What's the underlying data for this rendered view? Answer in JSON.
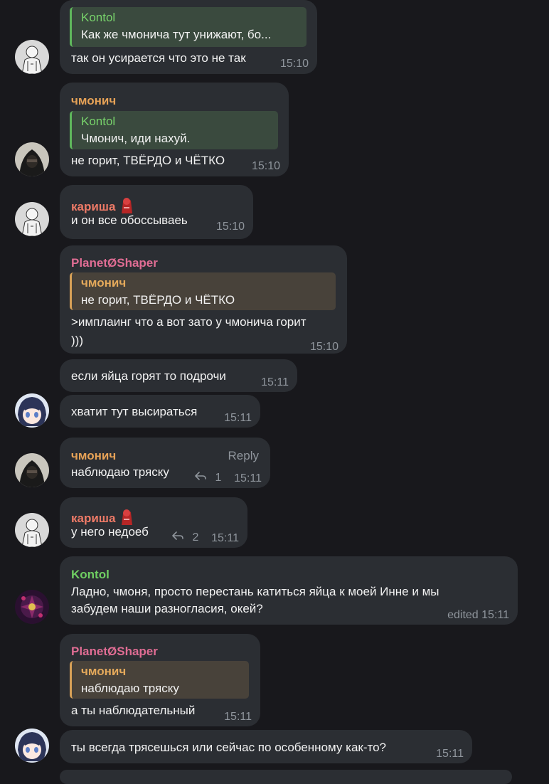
{
  "colors": {
    "background": "#18181c",
    "bubble": "#2b2e33",
    "name_chmonich": "#e6a257",
    "name_karisha": "#ee7a67",
    "name_planet": "#e06d94",
    "name_kontol": "#6fcf62",
    "time": "#8f959c"
  },
  "messages": [
    {
      "quote": {
        "name": "Kontol",
        "text": "Как же чмонича тут унижают, бо..."
      },
      "text": "так он усирается что это не так",
      "time": "15:10"
    },
    {
      "sender": "чмонич",
      "quote": {
        "name": "Kontol",
        "text": "Чмонич, иди нахуй."
      },
      "text": "не горит, ТВЁРДО и ЧЁТКО",
      "time": "15:10"
    },
    {
      "sender": "кариша",
      "text": "и он все обоссываеь",
      "time": "15:10"
    },
    {
      "sender": "PlanetØShaper",
      "quote": {
        "name": "чмонич",
        "text": "не горит, ТВЁРДО и ЧЁТКО"
      },
      "text_line1": ">имплаинг что а вот зато у чмонича горит",
      "text_line2": ")))",
      "time": "15:10"
    },
    {
      "text": "если яйца горят то подрочи",
      "time": "15:11"
    },
    {
      "text": "хватит тут высираться",
      "time": "15:11"
    },
    {
      "sender": "чмонич",
      "reply_label": "Reply",
      "text": "наблюдаю тряску",
      "replies": "1",
      "time": "15:11"
    },
    {
      "sender": "кариша",
      "text": "у него недоеб",
      "replies": "2",
      "time": "15:11"
    },
    {
      "sender": "Kontol",
      "text_line1": "Ладно, чмоня, просто перестань катиться яйца к моей Инне и мы",
      "text_line2": "забудем наши разногласия, окей?",
      "time": "edited 15:11"
    },
    {
      "sender": "PlanetØShaper",
      "quote": {
        "name": "чмонич",
        "text": "наблюдаю тряску"
      },
      "text": "а ты наблюдательный",
      "time": "15:11"
    },
    {
      "text": "ты всегда трясешься или сейчас по особенному как-то?",
      "time": "15:11"
    }
  ]
}
